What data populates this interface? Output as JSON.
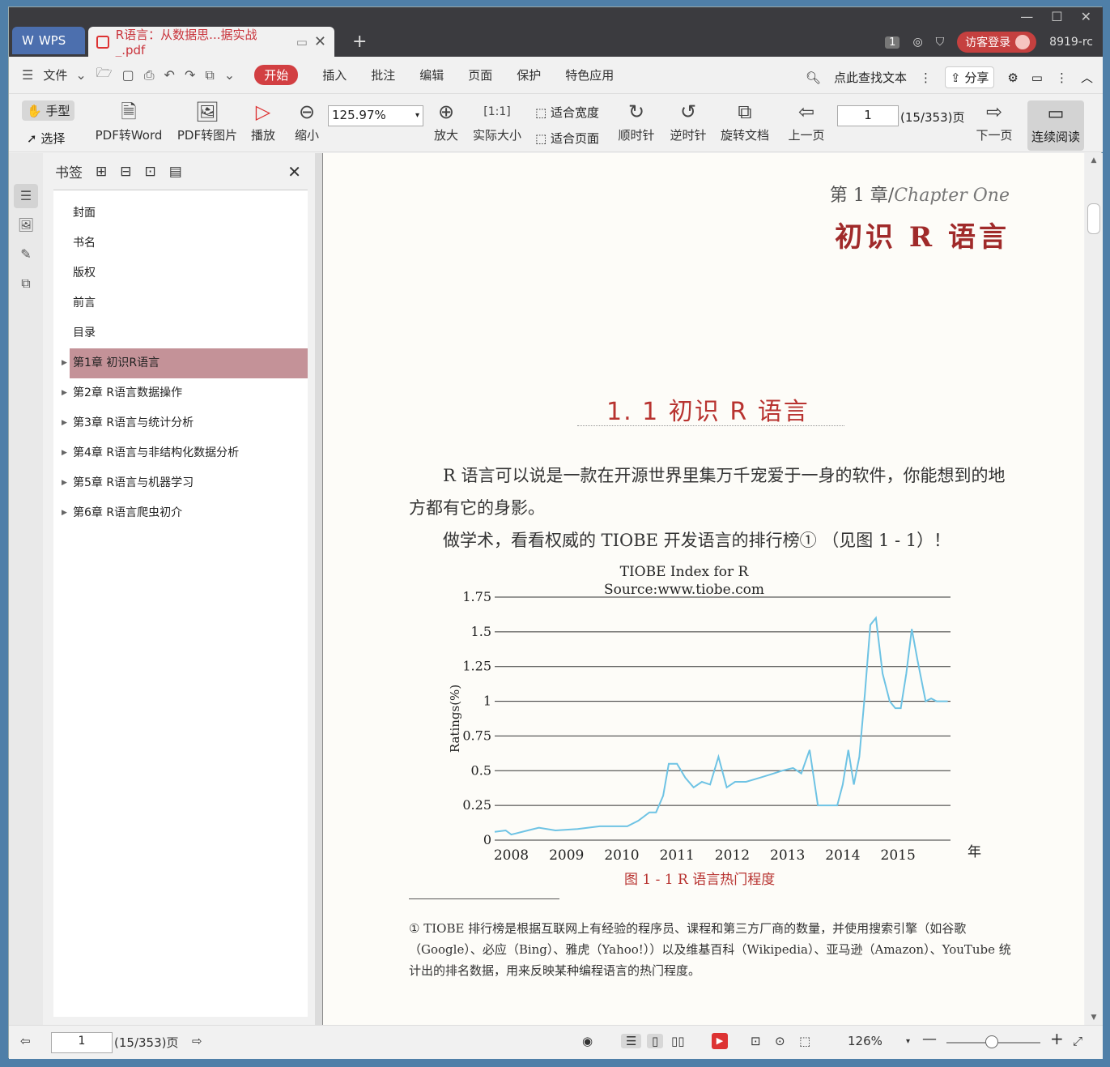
{
  "titlebar": {
    "app_name": "WPS",
    "doc_tab": "R语言：从数据思...据实战_.pdf",
    "badge": "1",
    "login": "访客登录",
    "user_code": "8919-rc"
  },
  "menu": {
    "file": "文件",
    "items": [
      "开始",
      "插入",
      "批注",
      "编辑",
      "页面",
      "保护",
      "特色应用"
    ],
    "search": "点此查找文本",
    "share": "分享"
  },
  "toolbar": {
    "hand": "手型",
    "select": "选择",
    "pdf_word": "PDF转Word",
    "pdf_img": "PDF转图片",
    "play": "播放",
    "zoom_out": "缩小",
    "zoom_value": "125.97%",
    "zoom_in": "放大",
    "actual": "实际大小",
    "fit_width": "适合宽度",
    "fit_page": "适合页面",
    "cw": "顺时针",
    "ccw": "逆时针",
    "rotate": "旋转文档",
    "prev": "上一页",
    "page": "1",
    "page_total": "(15/353)页",
    "next": "下一页",
    "continuous": "连续阅读"
  },
  "bookmarks": {
    "title": "书签",
    "items": [
      "封面",
      "书名",
      "版权",
      "前言",
      "目录",
      "第1章  初识R语言",
      "第2章  R语言数据操作",
      "第3章  R语言与统计分析",
      "第4章  R语言与非结构化数据分析",
      "第5章  R语言与机器学习",
      "第6章  R语言爬虫初介"
    ]
  },
  "page": {
    "chapter_label": "第 1 章",
    "chapter_en": "Chapter One",
    "chapter_title": "初识 R 语言",
    "section": "1. 1   初识 R 语言",
    "para1": "R 语言可以说是一款在开源世界里集万千宠爱于一身的软件，你能想到的地方都有它的身影。",
    "para2": "做学术，看看权威的 TIOBE 开发语言的排行榜① （见图 1 - 1）！",
    "caption": "图 1 - 1   R 语言热门程度",
    "footnote": "①   TIOBE 排行榜是根据互联网上有经验的程序员、课程和第三方厂商的数量，并使用搜索引擎（如谷歌（Google）、必应（Bing）、雅虎（Yahoo!））以及维基百科（Wikipedia）、亚马逊（Amazon）、YouTube 统计出的排名数据，用来反映某种编程语言的热门程度。"
  },
  "chart_data": {
    "type": "line",
    "title": "TIOBE Index for R",
    "subtitle": "Source:www.tiobe.com",
    "ylabel": "Ratings(%)",
    "xlabel": "年",
    "ylim": [
      0,
      1.75
    ],
    "xlim": [
      2007.7,
      2015.95
    ],
    "yticks": [
      "0",
      "0.25",
      "0.5",
      "0.75",
      "1",
      "1.25",
      "1.5",
      "1.75"
    ],
    "xticks": [
      "2008",
      "2009",
      "2010",
      "2011",
      "2012",
      "2013",
      "2014",
      "2015"
    ],
    "color": "#6ec3e4",
    "x": [
      2007.7,
      2007.9,
      2008.0,
      2008.3,
      2008.5,
      2008.8,
      2009.2,
      2009.6,
      2009.9,
      2010.1,
      2010.3,
      2010.5,
      2010.62,
      2010.75,
      2010.85,
      2011.0,
      2011.15,
      2011.3,
      2011.45,
      2011.6,
      2011.75,
      2011.9,
      2012.05,
      2012.25,
      2012.5,
      2012.75,
      2012.9,
      2013.1,
      2013.25,
      2013.4,
      2013.55,
      2013.7,
      2013.8,
      2013.9,
      2014.0,
      2014.1,
      2014.2,
      2014.3,
      2014.4,
      2014.5,
      2014.6,
      2014.72,
      2014.85,
      2014.95,
      2015.05,
      2015.15,
      2015.25,
      2015.35,
      2015.5,
      2015.6,
      2015.7,
      2015.8,
      2015.9
    ],
    "values": [
      0.06,
      0.07,
      0.04,
      0.07,
      0.09,
      0.07,
      0.08,
      0.1,
      0.1,
      0.1,
      0.14,
      0.2,
      0.2,
      0.32,
      0.55,
      0.55,
      0.45,
      0.38,
      0.42,
      0.4,
      0.6,
      0.38,
      0.42,
      0.42,
      0.45,
      0.48,
      0.5,
      0.52,
      0.48,
      0.65,
      0.25,
      0.25,
      0.25,
      0.25,
      0.4,
      0.65,
      0.4,
      0.6,
      1.05,
      1.55,
      1.6,
      1.2,
      1.0,
      0.95,
      0.95,
      1.2,
      1.52,
      1.3,
      1.0,
      1.02,
      1.0,
      1.0,
      1.0
    ]
  },
  "statusbar": {
    "page": "1",
    "page_total": "(15/353)页",
    "zoom": "126%"
  }
}
